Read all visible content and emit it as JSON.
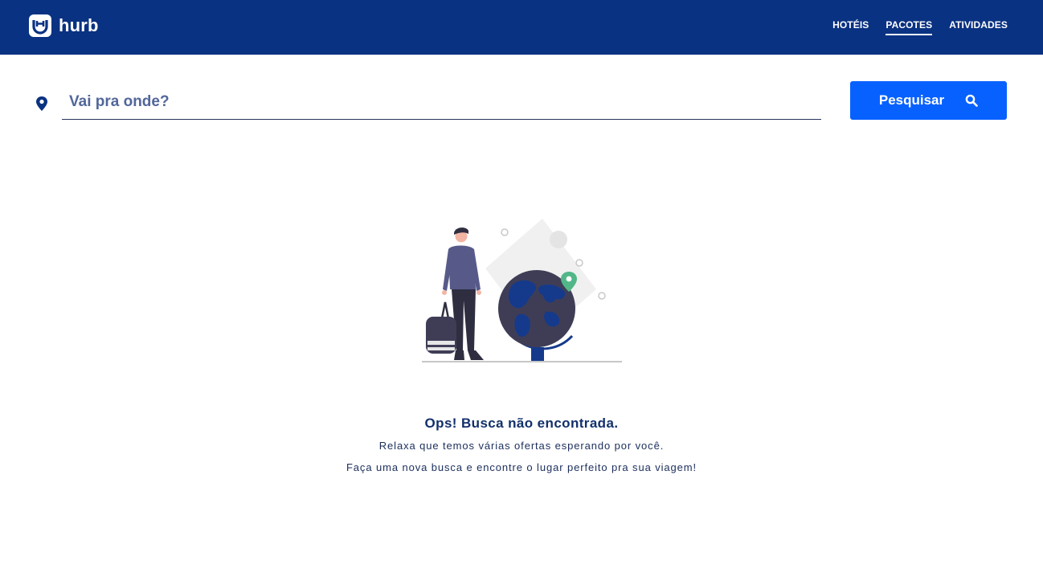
{
  "brand": {
    "name": "hurb"
  },
  "nav": {
    "items": [
      {
        "label": "HOTÉIS",
        "active": false
      },
      {
        "label": "PACOTES",
        "active": true
      },
      {
        "label": "ATIVIDADES",
        "active": false
      }
    ]
  },
  "search": {
    "placeholder": "Vai pra onde?",
    "value": "",
    "button_label": "Pesquisar"
  },
  "empty_state": {
    "title": "Ops! Busca não encontrada.",
    "line1": "Relaxa que temos várias ofertas esperando por você.",
    "line2": "Faça uma nova busca e encontre o lugar perfeito pra sua viagem!"
  },
  "colors": {
    "header_bg": "#0a3282",
    "primary_button": "#0761ff",
    "text_dark_blue": "#12306b"
  }
}
